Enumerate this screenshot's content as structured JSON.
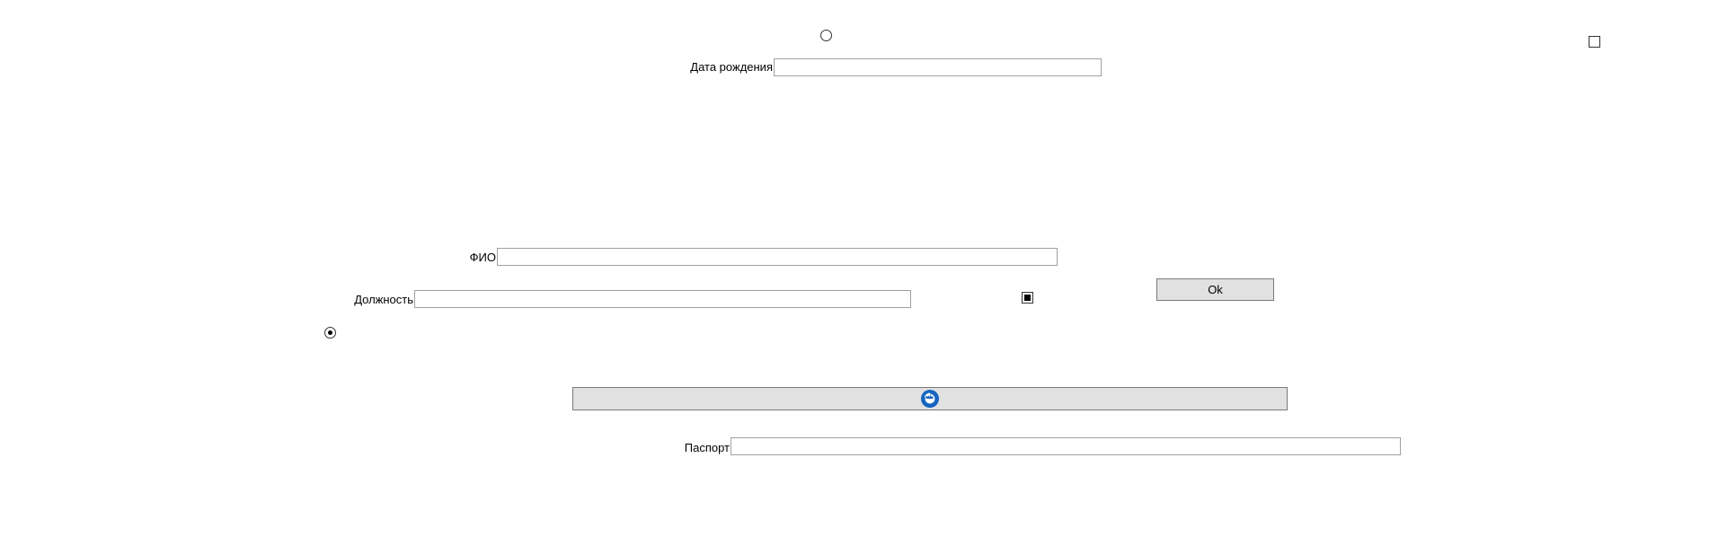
{
  "form": {
    "birthdate_label": "Дата рождения",
    "birthdate_value": "",
    "fio_label": "ФИО",
    "fio_value": "",
    "position_label": "Должность",
    "position_value": "",
    "passport_label": "Паспорт",
    "passport_value": "",
    "ok_label": "Ok"
  },
  "controls": {
    "radio_top_checked": false,
    "radio_left_checked": true,
    "checkbox_top_right_state": "unchecked",
    "checkbox_middle_state": "indeterminate"
  },
  "icons": {
    "wide_button_icon": "refresh-icon"
  },
  "colors": {
    "button_bg": "#e1e1e1",
    "button_border": "#7a7a7a",
    "textbox_border": "#a0a0a0",
    "icon_blue": "#1565c0"
  }
}
